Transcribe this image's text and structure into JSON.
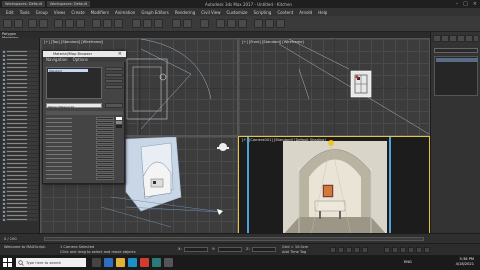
{
  "app": {
    "title": "Autodesk 3ds Max 2017 - Untitled - Kitchen",
    "tabs": [
      "Workspaces: Default",
      "Workspaces: Default"
    ]
  },
  "menu": [
    "Edit",
    "Tools",
    "Group",
    "Views",
    "Create",
    "Modifiers",
    "Animation",
    "Graph Editors",
    "Rendering",
    "Civil View",
    "Customize",
    "Scripting",
    "Content",
    "Arnold",
    "Help"
  ],
  "ribbon": {
    "label": "Polygon Modeling"
  },
  "viewports": {
    "top": "[+] [Top] [Standard] [Wireframe]",
    "front": "[+] [Front] [Standard] [Wireframe]",
    "left": "[+] [Left] [Standard] [Wireframe]",
    "persp": "[+] [Camera001] [Standard] [Default Shading]"
  },
  "material_dialog": {
    "title": "Material/Map Browser",
    "menu": [
      "Navigation",
      "Options"
    ],
    "list_selected": "Standard",
    "name_value": "Wall(s) Material 01"
  },
  "command_panel": {
    "icons": [
      "create-icon",
      "modify-icon",
      "hierarchy-icon",
      "motion-icon",
      "display-icon",
      "utilities-icon"
    ]
  },
  "status": {
    "selection": "1 Camera Selected",
    "prompt": "Click and drag to select and move objects",
    "welcome": "Welcome to MAXScript.",
    "x": "X:",
    "y": "Y:",
    "z": "Z:",
    "grid": "Grid = 10.0cm",
    "add_time_tag": "Add Time Tag",
    "frame": "0 / 100"
  },
  "taskbar": {
    "search_placeholder": "Type here to search",
    "time": "5:38 PM",
    "date": "4/18/2021",
    "lang": "ENG"
  },
  "colors": {
    "viewport_active": "#e7c63a",
    "selection_highlight": "#5a6d87",
    "light_gizmo": "#f2c81e"
  }
}
